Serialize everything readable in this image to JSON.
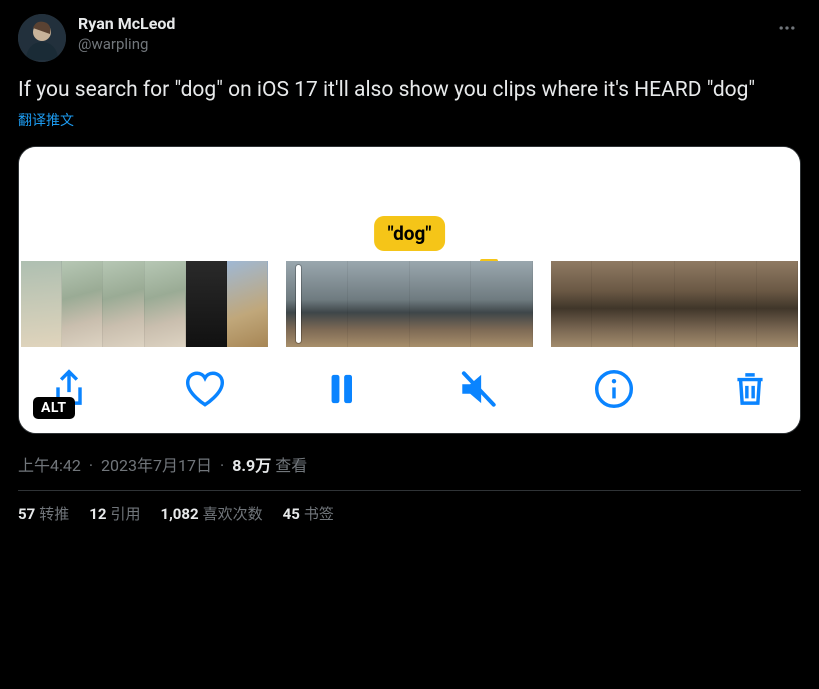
{
  "author": {
    "display_name": "Ryan McLeod",
    "handle": "@warpling"
  },
  "tweet_text": "If you search for \"dog\" on iOS 17 it'll also show you clips where it's HEARD \"dog\"",
  "translate_label": "翻译推文",
  "media": {
    "search_tag": "\"dog\"",
    "alt_badge": "ALT"
  },
  "timestamp": {
    "time": "上午4:42",
    "date": "2023年7月17日"
  },
  "views": {
    "count": "8.9万",
    "label": "查看"
  },
  "stats": {
    "retweets": {
      "n": "57",
      "label": "转推"
    },
    "quotes": {
      "n": "12",
      "label": "引用"
    },
    "likes": {
      "n": "1,082",
      "label": "喜欢次数"
    },
    "bookmarks": {
      "n": "45",
      "label": "书签"
    }
  }
}
